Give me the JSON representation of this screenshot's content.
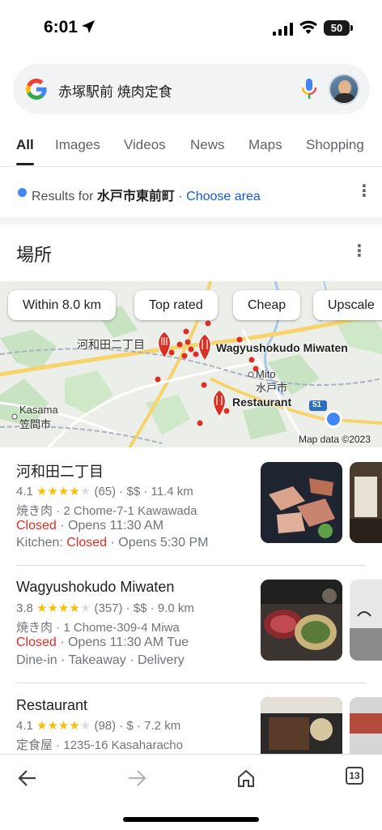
{
  "status_bar": {
    "time": "6:01",
    "battery": "50"
  },
  "search": {
    "query": "赤塚駅前 焼肉定食"
  },
  "tabs": [
    "All",
    "Images",
    "Videos",
    "News",
    "Maps",
    "Shopping"
  ],
  "location": {
    "prefix": "Results for",
    "place": "水戸市東前町",
    "separator": "·",
    "choose": "Choose area"
  },
  "section": {
    "title": "場所"
  },
  "map": {
    "chips": [
      "Within 8.0 km",
      "Top rated",
      "Cheap",
      "Upscale"
    ],
    "labels": {
      "kawawada": "河和田二丁目",
      "wagyu": "Wagyushokudo Miwaten",
      "mito_en": "Mito",
      "mito_ja": "水戸市",
      "restaurant": "Restaurant",
      "kasama_en": "Kasama",
      "kasama_ja": "笠間市",
      "route": "51",
      "attribution": "Map data ©2023"
    }
  },
  "places": [
    {
      "name": "河和田二丁目",
      "rating": "4.1",
      "reviews": "(65)",
      "price": "$$",
      "distance": "11.4 km",
      "stars": 4,
      "category": "焼き肉",
      "address": "2 Chome-7-1 Kawawada",
      "status": "Closed",
      "opens": "Opens 11:30 AM",
      "extra_label": "Kitchen:",
      "extra_status": "Closed",
      "extra_opens": "Opens 5:30 PM"
    },
    {
      "name": "Wagyushokudo Miwaten",
      "rating": "3.8",
      "reviews": "(357)",
      "price": "$$",
      "distance": "9.0 km",
      "stars": 4,
      "category": "焼き肉",
      "address": "1 Chome-309-4 Miwa",
      "status": "Closed",
      "opens": "Opens 11:30 AM Tue",
      "services": "Dine-in · Takeaway · Delivery"
    },
    {
      "name": "Restaurant",
      "rating": "4.1",
      "reviews": "(98)",
      "price": "$",
      "distance": "7.2 km",
      "stars": 4,
      "category": "定食屋",
      "address": "1235-16 Kasaharacho"
    }
  ],
  "bottom_bar": {
    "tab_count": "13"
  },
  "colors": {
    "accent": "#1558d6",
    "closed": "#d93025",
    "star": "#fbbc04",
    "pin": "#d93025"
  }
}
